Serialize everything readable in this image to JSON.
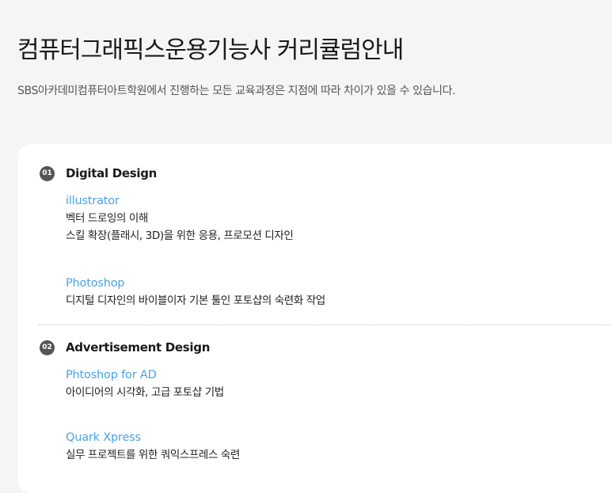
{
  "header": {
    "title": "컴퓨터그래픽스운용기능사 커리큘럼안내",
    "subtitle": "SBS아카데미컴퓨터아트학원에서 진행하는 모든 교육과정은 지점에 따라 차이가 있을 수 있습니다."
  },
  "sections": [
    {
      "number": "01",
      "title": "Digital Design",
      "courses": [
        {
          "name": "illustrator",
          "lines": [
            "벡터 드로잉의 이해",
            "스킬 확장(플래시, 3D)을 위한 응용, 프로모션 디자인"
          ]
        },
        {
          "name": "Photoshop",
          "lines": [
            "디지털 디자인의 바이블이자 기본 툴인 포토샵의 숙련화 작업"
          ]
        }
      ]
    },
    {
      "number": "02",
      "title": "Advertisement Design",
      "courses": [
        {
          "name": "Phtoshop for AD",
          "lines": [
            "아이디어의 시각화, 고급 포토샵 기법"
          ]
        },
        {
          "name": "Quark Xpress",
          "lines": [
            "실무 프로젝트를 위한 쿼익스프레스 숙련"
          ]
        }
      ]
    }
  ],
  "colors": {
    "accent": "#4aa3e6",
    "badge": "#555555",
    "background": "#f5f5f5",
    "card": "#ffffff"
  }
}
